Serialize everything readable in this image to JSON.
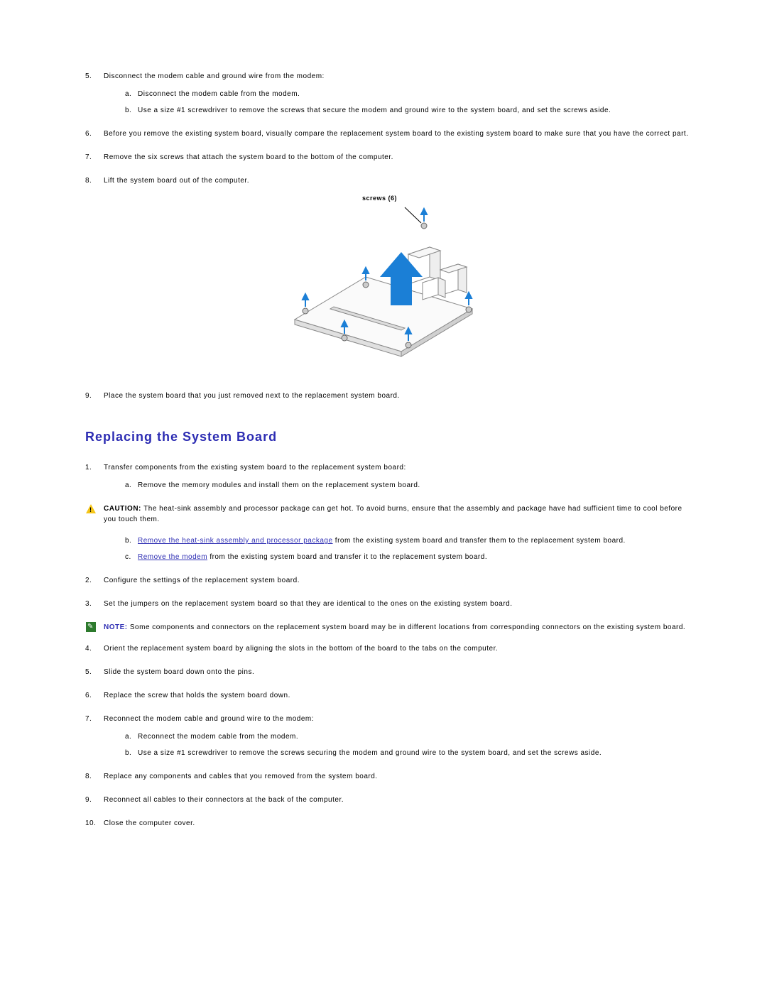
{
  "steps_top": {
    "five": {
      "n": "5.",
      "text": "Disconnect the modem cable and ground wire from the modem:",
      "a": {
        "l": "a.",
        "text": "Disconnect the modem cable from the modem."
      },
      "b": {
        "l": "b.",
        "text": "Use a size #1 screwdriver to remove the screws that secure the modem and ground wire to the system board, and set the screws aside."
      }
    },
    "six": {
      "n": "6.",
      "text": "Before you remove the existing system board, visually compare the replacement system board to the existing system board to make sure that you have the correct part."
    },
    "seven": {
      "n": "7.",
      "text": "Remove the six screws that attach the system board to the bottom of the computer."
    },
    "eight": {
      "n": "8.",
      "text": "Lift the system board out of the computer."
    },
    "nine": {
      "n": "9.",
      "text": "Place the system board that you just removed next to the replacement system board."
    }
  },
  "diagram": {
    "screws_label": "screws (6)"
  },
  "heading": "Replacing the System Board",
  "replace": {
    "one": {
      "n": "1.",
      "text": "Transfer components from the existing system board to the replacement system board:",
      "a": {
        "l": "a.",
        "text": "Remove the memory modules and install them on the replacement system board."
      }
    },
    "caution": {
      "label": "CAUTION: ",
      "text": "The heat-sink assembly and processor package can get hot. To avoid burns, ensure that the assembly and package have had sufficient time to cool before you touch them."
    },
    "one_b": {
      "l": "b.",
      "link": "Remove the heat-sink assembly and processor package",
      "tail": " from the existing system board and transfer them to the replacement system board."
    },
    "one_c": {
      "l": "c.",
      "link": "Remove the modem",
      "tail": " from the existing system board and transfer it to the replacement system board."
    },
    "two": {
      "n": "2.",
      "text": "Configure the settings of the replacement system board."
    },
    "three": {
      "n": "3.",
      "text": "Set the jumpers on the replacement system board so that they are identical to the ones on the existing system board."
    },
    "note": {
      "label": "NOTE: ",
      "text": "Some components and connectors on the replacement system board may be in different locations from corresponding connectors on the existing system board."
    },
    "four": {
      "n": "4.",
      "text": "Orient the replacement system board by aligning the slots in the bottom of the board to the tabs on the computer."
    },
    "five": {
      "n": "5.",
      "text": "Slide the system board down onto the pins."
    },
    "six": {
      "n": "6.",
      "text": "Replace the screw that holds the system board down."
    },
    "seven": {
      "n": "7.",
      "text": "Reconnect the modem cable and ground wire to the modem:",
      "a": {
        "l": "a.",
        "text": "Reconnect the modem cable from the modem."
      },
      "b": {
        "l": "b.",
        "text": "Use a size #1 screwdriver to remove the screws securing the modem and ground wire to the system board, and set the screws aside."
      }
    },
    "eight": {
      "n": "8.",
      "text": "Replace any components and cables that you removed from the system board."
    },
    "nine": {
      "n": "9.",
      "text": "Reconnect all cables to their connectors at the back of the computer."
    },
    "ten": {
      "n": "10.",
      "text": "Close the computer cover."
    }
  }
}
